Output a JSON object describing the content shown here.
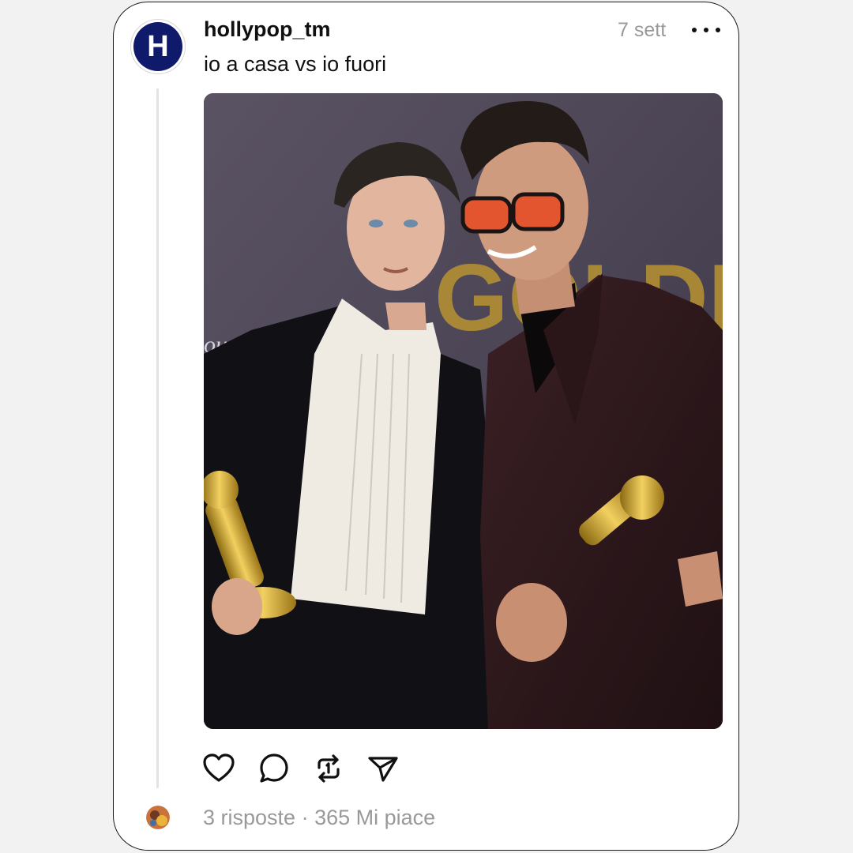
{
  "post": {
    "avatar_letter": "H",
    "username": "hollypop_tm",
    "time": "7 sett",
    "caption": "io a casa vs io fuori",
    "photo_bg_text": "GOLDEN",
    "photo_logo_text": "ount"
  },
  "actions": [
    {
      "name": "like-icon"
    },
    {
      "name": "comment-icon"
    },
    {
      "name": "repost-icon"
    },
    {
      "name": "share-icon"
    }
  ],
  "footer": {
    "replies": "3 risposte",
    "separator": " · ",
    "likes": "365 Mi piace"
  },
  "colors": {
    "avatar_bg": "#0f1a6b",
    "muted_text": "#999999",
    "primary_text": "#101010"
  }
}
